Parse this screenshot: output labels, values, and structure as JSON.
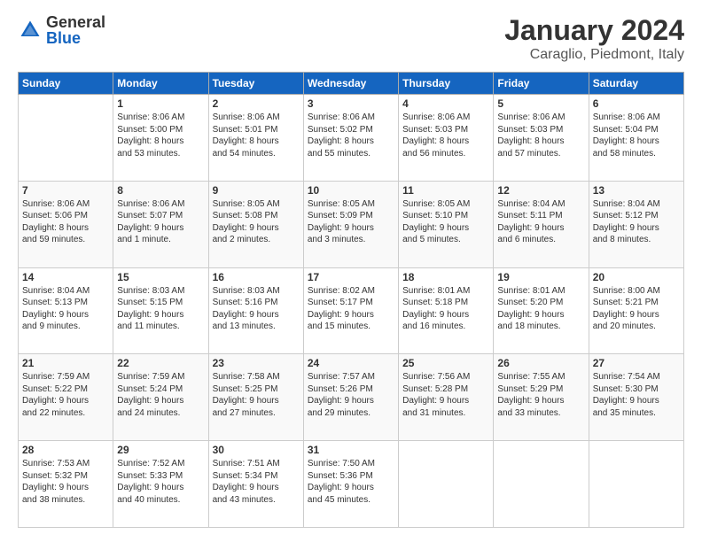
{
  "header": {
    "logo_general": "General",
    "logo_blue": "Blue",
    "month_title": "January 2024",
    "location": "Caraglio, Piedmont, Italy"
  },
  "days_of_week": [
    "Sunday",
    "Monday",
    "Tuesday",
    "Wednesday",
    "Thursday",
    "Friday",
    "Saturday"
  ],
  "weeks": [
    [
      {
        "day": "",
        "info": ""
      },
      {
        "day": "1",
        "info": "Sunrise: 8:06 AM\nSunset: 5:00 PM\nDaylight: 8 hours\nand 53 minutes."
      },
      {
        "day": "2",
        "info": "Sunrise: 8:06 AM\nSunset: 5:01 PM\nDaylight: 8 hours\nand 54 minutes."
      },
      {
        "day": "3",
        "info": "Sunrise: 8:06 AM\nSunset: 5:02 PM\nDaylight: 8 hours\nand 55 minutes."
      },
      {
        "day": "4",
        "info": "Sunrise: 8:06 AM\nSunset: 5:03 PM\nDaylight: 8 hours\nand 56 minutes."
      },
      {
        "day": "5",
        "info": "Sunrise: 8:06 AM\nSunset: 5:03 PM\nDaylight: 8 hours\nand 57 minutes."
      },
      {
        "day": "6",
        "info": "Sunrise: 8:06 AM\nSunset: 5:04 PM\nDaylight: 8 hours\nand 58 minutes."
      }
    ],
    [
      {
        "day": "7",
        "info": "Sunrise: 8:06 AM\nSunset: 5:06 PM\nDaylight: 8 hours\nand 59 minutes."
      },
      {
        "day": "8",
        "info": "Sunrise: 8:06 AM\nSunset: 5:07 PM\nDaylight: 9 hours\nand 1 minute."
      },
      {
        "day": "9",
        "info": "Sunrise: 8:05 AM\nSunset: 5:08 PM\nDaylight: 9 hours\nand 2 minutes."
      },
      {
        "day": "10",
        "info": "Sunrise: 8:05 AM\nSunset: 5:09 PM\nDaylight: 9 hours\nand 3 minutes."
      },
      {
        "day": "11",
        "info": "Sunrise: 8:05 AM\nSunset: 5:10 PM\nDaylight: 9 hours\nand 5 minutes."
      },
      {
        "day": "12",
        "info": "Sunrise: 8:04 AM\nSunset: 5:11 PM\nDaylight: 9 hours\nand 6 minutes."
      },
      {
        "day": "13",
        "info": "Sunrise: 8:04 AM\nSunset: 5:12 PM\nDaylight: 9 hours\nand 8 minutes."
      }
    ],
    [
      {
        "day": "14",
        "info": "Sunrise: 8:04 AM\nSunset: 5:13 PM\nDaylight: 9 hours\nand 9 minutes."
      },
      {
        "day": "15",
        "info": "Sunrise: 8:03 AM\nSunset: 5:15 PM\nDaylight: 9 hours\nand 11 minutes."
      },
      {
        "day": "16",
        "info": "Sunrise: 8:03 AM\nSunset: 5:16 PM\nDaylight: 9 hours\nand 13 minutes."
      },
      {
        "day": "17",
        "info": "Sunrise: 8:02 AM\nSunset: 5:17 PM\nDaylight: 9 hours\nand 15 minutes."
      },
      {
        "day": "18",
        "info": "Sunrise: 8:01 AM\nSunset: 5:18 PM\nDaylight: 9 hours\nand 16 minutes."
      },
      {
        "day": "19",
        "info": "Sunrise: 8:01 AM\nSunset: 5:20 PM\nDaylight: 9 hours\nand 18 minutes."
      },
      {
        "day": "20",
        "info": "Sunrise: 8:00 AM\nSunset: 5:21 PM\nDaylight: 9 hours\nand 20 minutes."
      }
    ],
    [
      {
        "day": "21",
        "info": "Sunrise: 7:59 AM\nSunset: 5:22 PM\nDaylight: 9 hours\nand 22 minutes."
      },
      {
        "day": "22",
        "info": "Sunrise: 7:59 AM\nSunset: 5:24 PM\nDaylight: 9 hours\nand 24 minutes."
      },
      {
        "day": "23",
        "info": "Sunrise: 7:58 AM\nSunset: 5:25 PM\nDaylight: 9 hours\nand 27 minutes."
      },
      {
        "day": "24",
        "info": "Sunrise: 7:57 AM\nSunset: 5:26 PM\nDaylight: 9 hours\nand 29 minutes."
      },
      {
        "day": "25",
        "info": "Sunrise: 7:56 AM\nSunset: 5:28 PM\nDaylight: 9 hours\nand 31 minutes."
      },
      {
        "day": "26",
        "info": "Sunrise: 7:55 AM\nSunset: 5:29 PM\nDaylight: 9 hours\nand 33 minutes."
      },
      {
        "day": "27",
        "info": "Sunrise: 7:54 AM\nSunset: 5:30 PM\nDaylight: 9 hours\nand 35 minutes."
      }
    ],
    [
      {
        "day": "28",
        "info": "Sunrise: 7:53 AM\nSunset: 5:32 PM\nDaylight: 9 hours\nand 38 minutes."
      },
      {
        "day": "29",
        "info": "Sunrise: 7:52 AM\nSunset: 5:33 PM\nDaylight: 9 hours\nand 40 minutes."
      },
      {
        "day": "30",
        "info": "Sunrise: 7:51 AM\nSunset: 5:34 PM\nDaylight: 9 hours\nand 43 minutes."
      },
      {
        "day": "31",
        "info": "Sunrise: 7:50 AM\nSunset: 5:36 PM\nDaylight: 9 hours\nand 45 minutes."
      },
      {
        "day": "",
        "info": ""
      },
      {
        "day": "",
        "info": ""
      },
      {
        "day": "",
        "info": ""
      }
    ]
  ]
}
